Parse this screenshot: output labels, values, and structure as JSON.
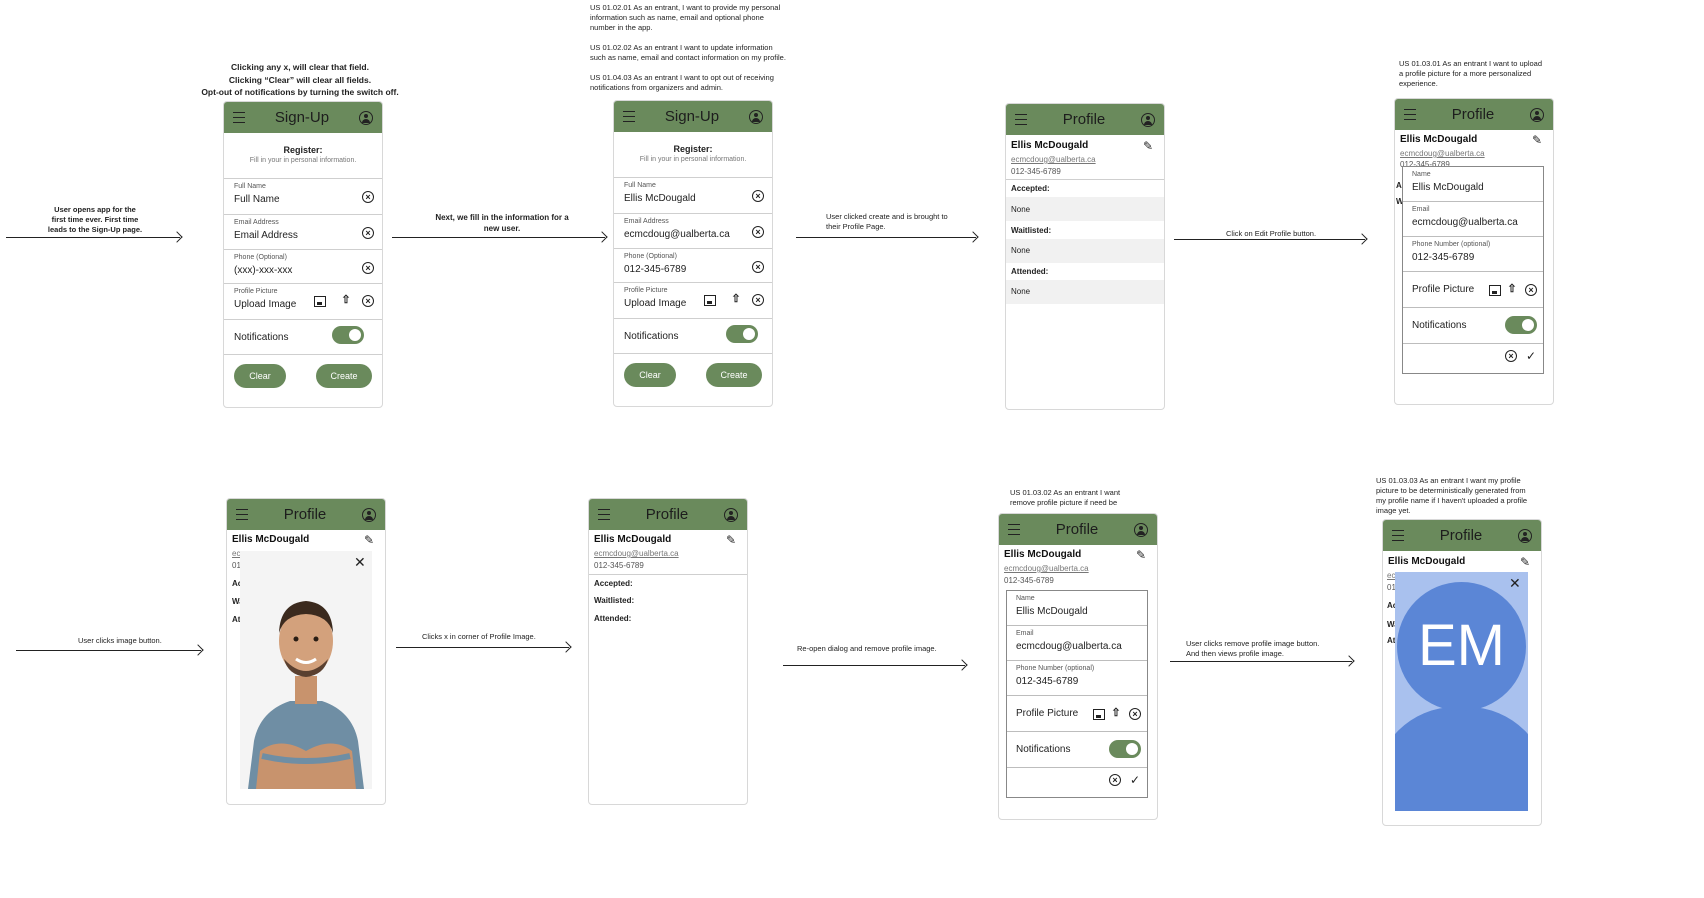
{
  "notes": {
    "signup_instructions": [
      "Clicking any x, will clear that field.",
      "Clicking “Clear” will clear all fields.",
      "Opt-out of notifications by turning the switch off."
    ],
    "user_opens": [
      "User opens app for the",
      "first time ever. First time",
      "leads to the Sign-Up page."
    ],
    "fill_in": [
      "Next, we fill in the information for a",
      "new user."
    ],
    "user_stories_top": [
      "US 01.02.01 As an entrant, I want to provide my personal",
      "information such as name, email and optional phone",
      "number in the app.",
      "",
      "US 01.02.02 As an entrant I want to update information",
      "such as name, email and contact information on my profile.",
      "",
      "US 01.04.03 As an entrant I want to opt out of receiving",
      "notifications from organizers and admin."
    ],
    "clicked_create": [
      "User clicked create and is brought to",
      "their Profile Page."
    ],
    "click_edit": "Click on Edit Profile button.",
    "us_upload": [
      "US 01.03.01 As an entrant I want to upload",
      "a profile picture for a more personalized",
      "experience."
    ],
    "clicks_image": "User clicks image button.",
    "clicks_x": "Clicks x in corner of Profile Image.",
    "reopen": "Re-open dialog and remove profile image.",
    "us_remove": [
      "US 01.03.02 As an entrant I want",
      "remove profile picture if need be"
    ],
    "remove_views": [
      "User clicks remove profile image button.",
      "And then views profile image."
    ],
    "us_generated": [
      "US 01.03.03 As an entrant I want my profile",
      "picture to be deterministically generated from",
      "my profile name if I haven't uploaded a profile",
      "image yet."
    ]
  },
  "signup": {
    "title": "Sign-Up",
    "register": "Register:",
    "register_sub": "Fill in your in personal information.",
    "full_name_label": "Full Name",
    "email_label": "Email Address",
    "phone_label": "Phone (Optional)",
    "picture_label": "Profile Picture",
    "upload_image": "Upload Image",
    "notifications": "Notifications",
    "clear": "Clear",
    "create": "Create",
    "empty": {
      "full_name": "Full Name",
      "email": "Email Address",
      "phone": "(xxx)-xxx-xxx"
    },
    "filled": {
      "full_name": "Ellis McDougald",
      "email": "ecmcdoug@ualberta.ca",
      "phone": "012-345-6789"
    }
  },
  "profile": {
    "title": "Profile",
    "name": "Ellis McDougald",
    "email": "ecmcdoug@ualberta.ca",
    "phone": "012-345-6789",
    "accepted": "Accepted:",
    "waitlisted": "Waitlisted:",
    "attended": "Attended:",
    "none": "None"
  },
  "dialog": {
    "name_label": "Name",
    "email_label": "Email",
    "phone_label": "Phone Number (optional)",
    "picture_label": "Profile Picture",
    "notifications": "Notifications"
  },
  "obscured": {
    "ac": "Ac",
    "wa": "Wa",
    "at": "At",
    "w": "W",
    "a": "A",
    "email_partial": "ec",
    "phone_partial": "01",
    "email_partial2": "ecr",
    "phone_partial_top": "012-345-6789"
  },
  "avatar_initials": "EM",
  "colors": {
    "accent": "#6a8a5c",
    "avatar": "#5b86d6",
    "avatar_bg": "#a9c1ee"
  }
}
